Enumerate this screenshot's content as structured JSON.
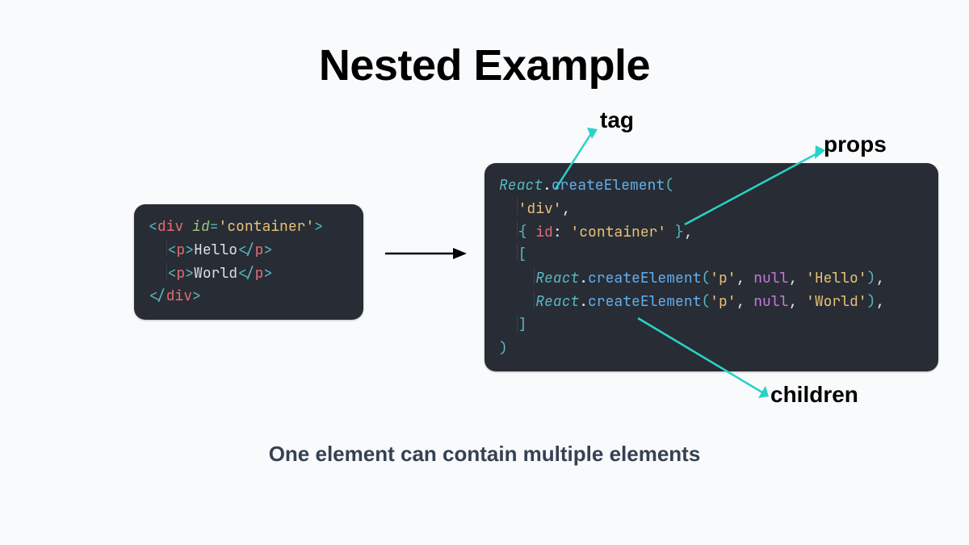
{
  "title": "Nested Example",
  "caption": "One element can contain multiple elements",
  "labels": {
    "tag": "tag",
    "props": "props",
    "children": "children"
  },
  "code_left": {
    "l1": {
      "open": "<",
      "tag": "div",
      "sp": " ",
      "attr": "id",
      "eq": "=",
      "val": "'container'",
      "close": ">"
    },
    "l2": {
      "open": "<",
      "tag": "p",
      "close": ">",
      "text": "Hello",
      "open2": "</",
      "close2": ">"
    },
    "l3": {
      "open": "<",
      "tag": "p",
      "close": ">",
      "text": "World",
      "open2": "</",
      "close2": ">"
    },
    "l4": {
      "open": "</",
      "tag": "div",
      "close": ">"
    }
  },
  "code_right": {
    "l1": {
      "cls": "React",
      "dot": ".",
      "fn": "createElement",
      "open": "("
    },
    "l2": {
      "val": "'div'",
      "comma": ","
    },
    "l3": {
      "open": "{ ",
      "prop": "id",
      "colon": ": ",
      "val": "'container'",
      "close": " }",
      "comma": ","
    },
    "l4": {
      "open": "["
    },
    "l5": {
      "cls": "React",
      "dot": ".",
      "fn": "createElement",
      "open": "(",
      "a1": "'p'",
      "c1": ", ",
      "a2": "null",
      "c2": ", ",
      "a3": "'Hello'",
      "close": ")",
      "comma": ","
    },
    "l6": {
      "cls": "React",
      "dot": ".",
      "fn": "createElement",
      "open": "(",
      "a1": "'p'",
      "c1": ", ",
      "a2": "null",
      "c2": ", ",
      "a3": "'World'",
      "close": ")",
      "comma": ","
    },
    "l7": {
      "close": "]"
    },
    "l8": {
      "close": ")"
    }
  }
}
